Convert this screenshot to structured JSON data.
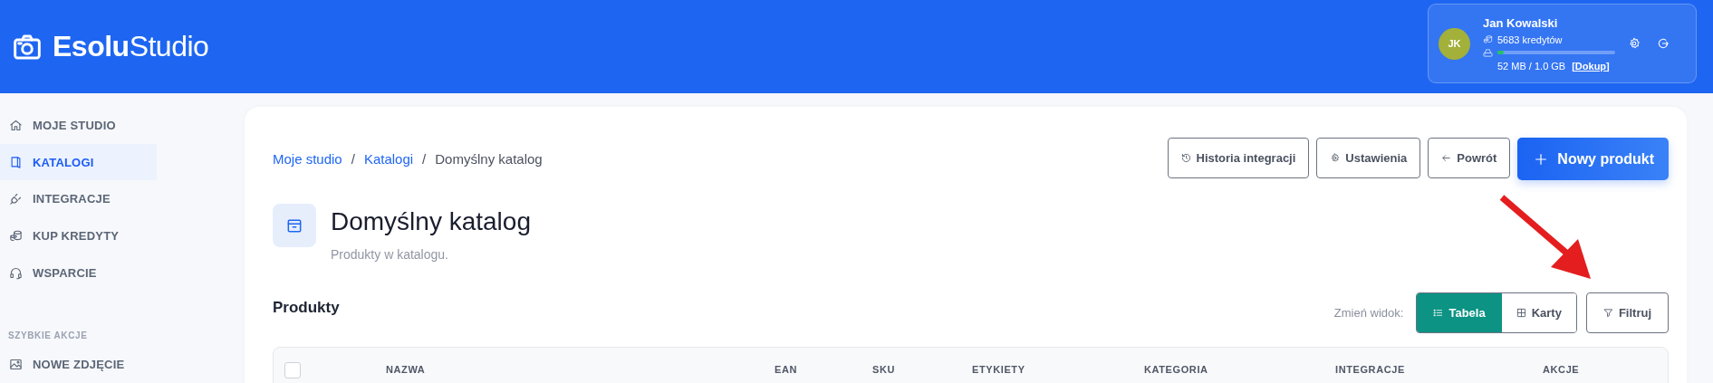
{
  "header": {
    "logo": {
      "bold": "Esolu",
      "light": "Studio"
    },
    "user": {
      "initials": "JK",
      "name": "Jan Kowalski",
      "credits": "5683 kredytów",
      "storage": {
        "text": "52 MB / 1.0 GB",
        "level": 0.05,
        "link": "[Dokup]"
      }
    }
  },
  "sidebar": {
    "items": [
      {
        "label": "MOJE STUDIO",
        "selected": false
      },
      {
        "label": "KATALOGI",
        "selected": true
      },
      {
        "label": "INTEGRACJE",
        "selected": false
      },
      {
        "label": "KUP KREDYTY",
        "selected": false
      },
      {
        "label": "WSPARCIE",
        "selected": false
      }
    ],
    "sections": [
      {
        "title": "SZYBKIE AKCJE",
        "items": [
          {
            "label": "NOWE ZDJĘCIE",
            "selected": false
          }
        ]
      }
    ]
  },
  "breadcrumb_separator": "/",
  "breadcrumb": [
    {
      "label": "Moje studio",
      "kind": "link"
    },
    {
      "label": "Katalogi",
      "kind": "link"
    },
    {
      "label": "Domyślny katalog",
      "kind": "current"
    }
  ],
  "actions": [
    {
      "label": "Historia integracji",
      "kind": "outline"
    },
    {
      "label": "Ustawienia",
      "kind": "outline"
    },
    {
      "label": "Powrót",
      "kind": "outline"
    },
    {
      "label": "Nowy produkt",
      "kind": "primary"
    }
  ],
  "page": {
    "title": "Domyślny katalog",
    "subtitle": "Produkty w katalogu."
  },
  "products": {
    "title": "Produkty",
    "view_label": "Zmień widok:",
    "views": [
      {
        "label": "Tabela",
        "selected": true
      },
      {
        "label": "Karty",
        "selected": false
      }
    ],
    "filter_button": "Filtruj",
    "table": {
      "select_all": {
        "checked": false
      },
      "columns": [
        {
          "label": "NAZWA"
        },
        {
          "label": "EAN"
        },
        {
          "label": "SKU"
        },
        {
          "label": "ETYKIETY"
        },
        {
          "label": "KATEGORIA"
        },
        {
          "label": "INTEGRACJE"
        },
        {
          "label": "AKCJE"
        }
      ]
    }
  }
}
